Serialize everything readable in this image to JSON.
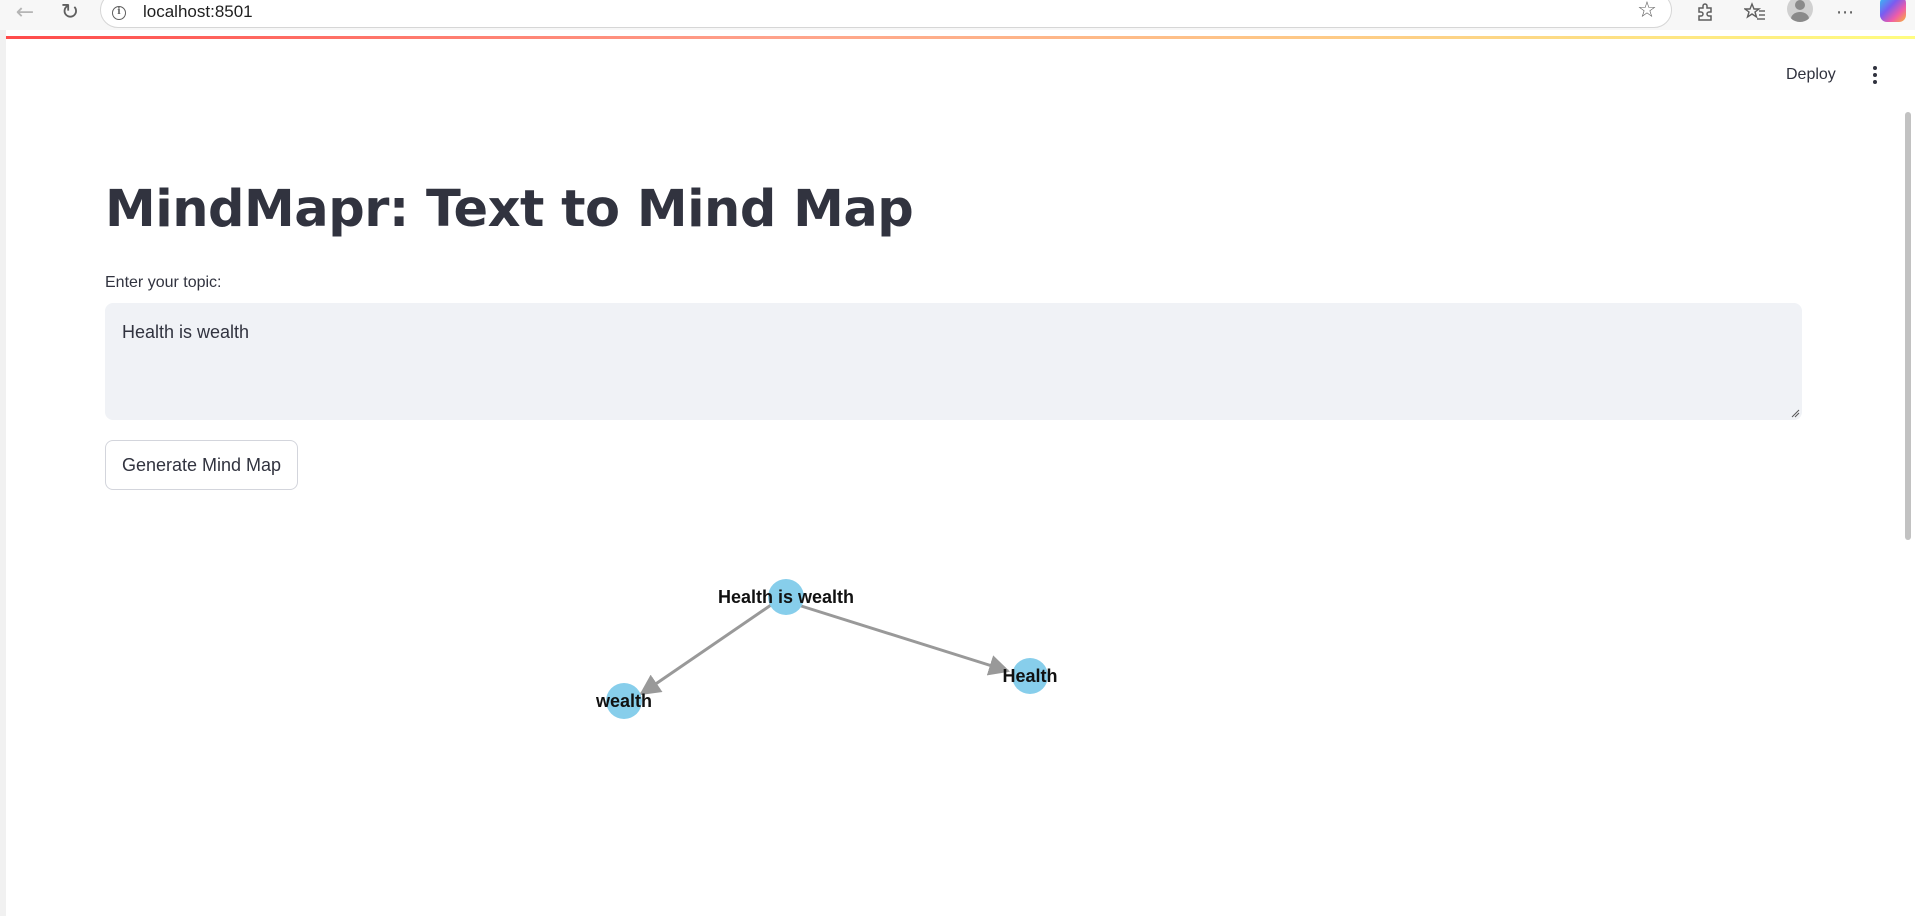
{
  "browser": {
    "url": "localhost:8501",
    "icons": [
      "back-arrow-icon",
      "reload-icon",
      "info-icon",
      "star-icon",
      "extensions-icon",
      "favorites-icon",
      "profile-icon",
      "more-icon",
      "copilot-icon"
    ]
  },
  "app": {
    "deploy_label": "Deploy",
    "title": "MindMapr: Text to Mind Map",
    "input_label": "Enter your topic:",
    "input_value": "Health is wealth",
    "button_label": "Generate Mind Map"
  },
  "mindmap": {
    "root": "Health is wealth",
    "children": [
      "wealth",
      "Health"
    ],
    "node_color": "#87ceeb",
    "edge_color": "#999999"
  },
  "colors": {
    "accent": "#ff4b4b",
    "text": "#31333f",
    "input_bg": "#f0f2f6"
  }
}
